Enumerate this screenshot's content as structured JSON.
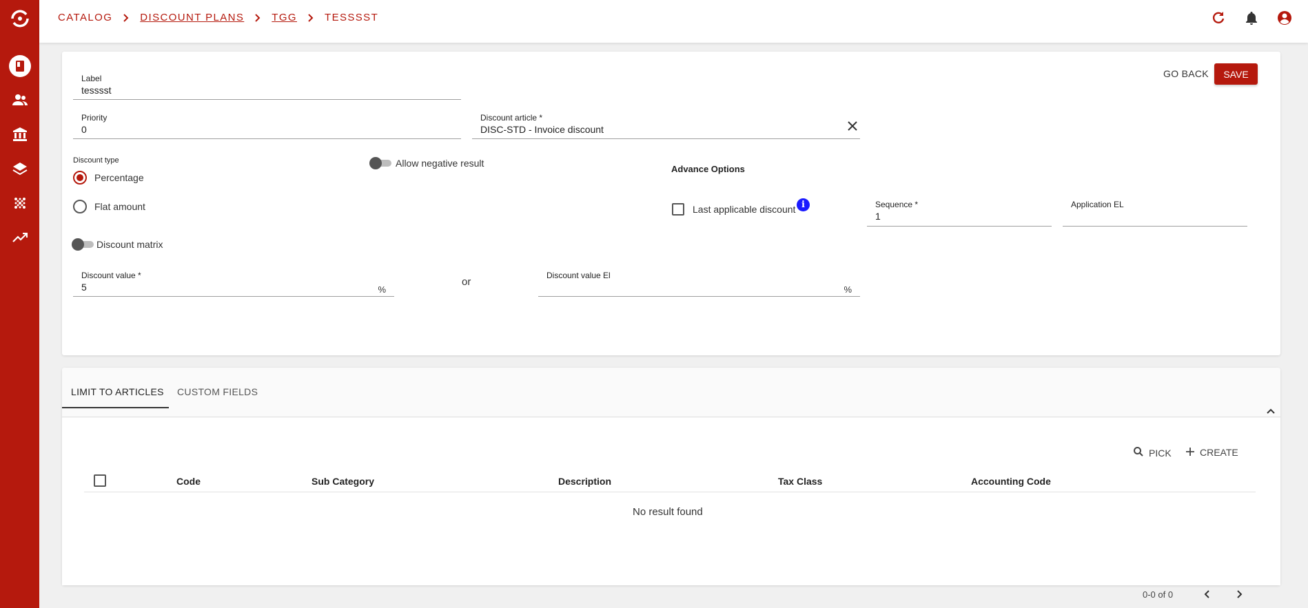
{
  "breadcrumb": {
    "catalog": "CATALOG",
    "discount_plans": "DISCOUNT PLANS",
    "tgg": "TGG",
    "current": "TESSSST"
  },
  "colors": {
    "accent": "#b5190d",
    "info": "#1a1aff"
  },
  "sidebar": {
    "icons": [
      "app-logo-icon",
      "book-icon",
      "people-icon",
      "bank-icon",
      "layers-icon",
      "grid-dots-icon",
      "trending-up-icon"
    ]
  },
  "header_icons": [
    "refresh-icon",
    "bell-icon",
    "account-circle-icon"
  ],
  "form": {
    "go_back": "GO BACK",
    "save": "SAVE",
    "label_field": {
      "label": "Label",
      "value": "tesssst"
    },
    "priority_field": {
      "label": "Priority",
      "value": "0"
    },
    "discount_article_field": {
      "label": "Discount article *",
      "value": "DISC-STD - Invoice discount"
    },
    "discount_type": {
      "label": "Discount type",
      "options": [
        {
          "label": "Percentage",
          "checked": true
        },
        {
          "label": "Flat amount",
          "checked": false
        }
      ]
    },
    "allow_negative": {
      "label": "Allow negative result",
      "on": false
    },
    "discount_matrix": {
      "label": "Discount matrix",
      "on": false
    },
    "discount_value": {
      "label": "Discount value *",
      "value": "5",
      "suffix": "%"
    },
    "or_text": "or",
    "discount_value_el": {
      "label": "Discount value El",
      "value": "",
      "suffix": "%"
    },
    "advance_options": {
      "title": "Advance Options",
      "last_applicable": {
        "label": "Last applicable discount",
        "checked": false
      },
      "sequence": {
        "label": "Sequence *",
        "value": "1"
      },
      "application_el": {
        "label": "Application EL",
        "value": ""
      }
    }
  },
  "tabs": [
    {
      "label": "LIMIT TO ARTICLES",
      "active": true
    },
    {
      "label": "CUSTOM FIELDS",
      "active": false
    }
  ],
  "table": {
    "actions": {
      "pick": "PICK",
      "create": "CREATE"
    },
    "columns": [
      "Code",
      "Sub Category",
      "Description",
      "Tax Class",
      "Accounting Code"
    ],
    "rows": [],
    "empty_text": "No result found",
    "pagination": "0-0 of 0"
  }
}
